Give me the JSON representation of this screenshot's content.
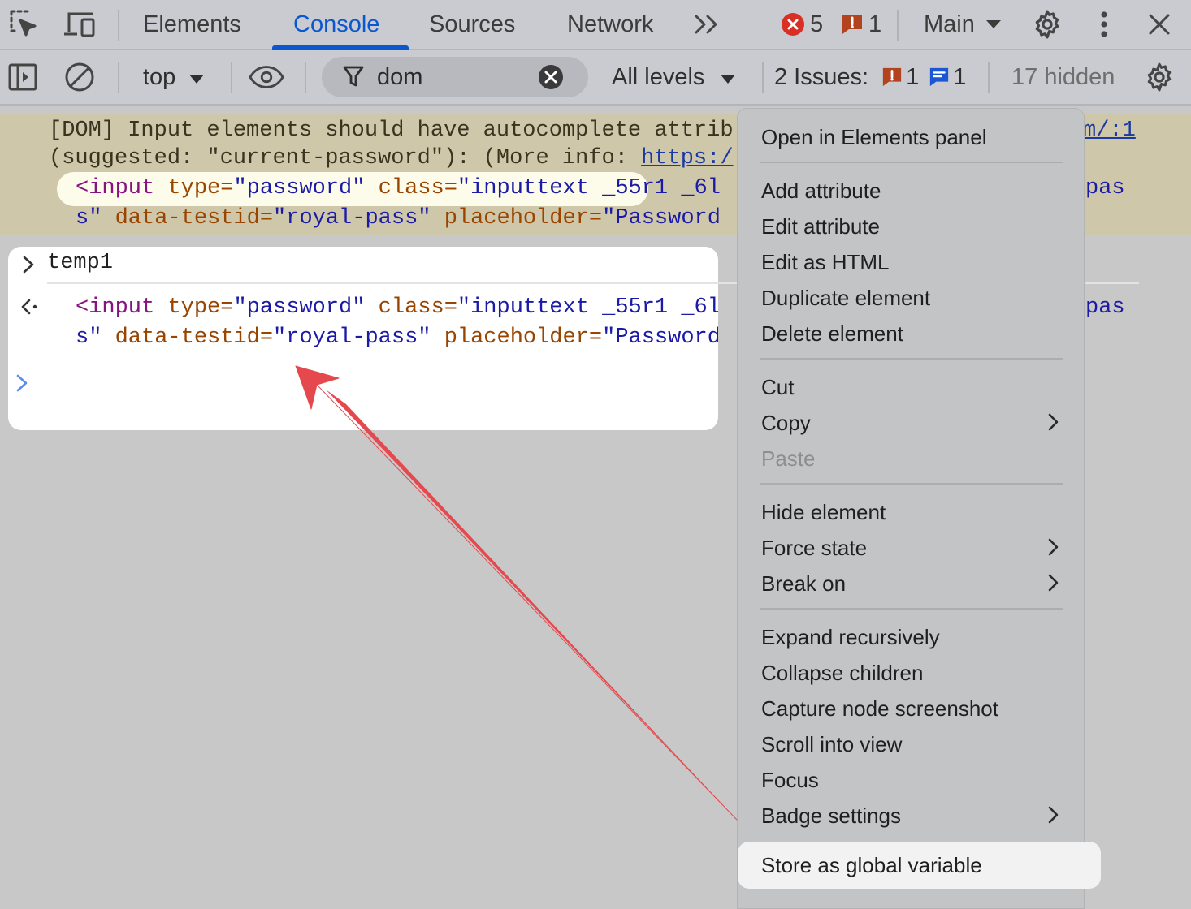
{
  "tabs": {
    "elements": "Elements",
    "console": "Console",
    "sources": "Sources",
    "network": "Network"
  },
  "header": {
    "error_count": "5",
    "warning_count": "1",
    "context": "Main"
  },
  "toolbar": {
    "context": "top",
    "filter_value": "dom",
    "levels": "All levels",
    "issues_label": "2 Issues:",
    "issues_warning": "1",
    "issues_info": "1",
    "hidden": "17 hidden"
  },
  "console": {
    "warning_line1": "[DOM] Input elements should have autocomplete attrib",
    "warning_line2_pre": "(suggested: \"current-password\"): (More info: ",
    "warning_link": "https:/",
    "warning_source": "m/:1",
    "code": {
      "tag_open": "<input",
      "attr_type": "type",
      "val_type": "\"password\"",
      "attr_class": "class",
      "val_class": "\"inputtext _55r1 _6l",
      "val_tail": "pas",
      "val_cont": "s\"",
      "attr_testid": "data-testid",
      "val_testid": "\"royal-pass\"",
      "attr_placeholder": "placeholder",
      "val_placeholder": "\"Password"
    },
    "input_command": "temp1"
  },
  "menu": {
    "open_in_elements": "Open in Elements panel",
    "add_attribute": "Add attribute",
    "edit_attribute": "Edit attribute",
    "edit_as_html": "Edit as HTML",
    "duplicate_element": "Duplicate element",
    "delete_element": "Delete element",
    "cut": "Cut",
    "copy": "Copy",
    "paste": "Paste",
    "hide_element": "Hide element",
    "force_state": "Force state",
    "break_on": "Break on",
    "expand_recursively": "Expand recursively",
    "collapse_children": "Collapse children",
    "capture_node_screenshot": "Capture node screenshot",
    "scroll_into_view": "Scroll into view",
    "focus": "Focus",
    "badge_settings": "Badge settings",
    "store_as_global_variable": "Store as global variable"
  },
  "colors": {
    "accent": "#0b57d0",
    "error": "#d93025",
    "warning": "#b3421e",
    "info": "#1a56d6",
    "annotation_arrow": "#e5484d"
  }
}
